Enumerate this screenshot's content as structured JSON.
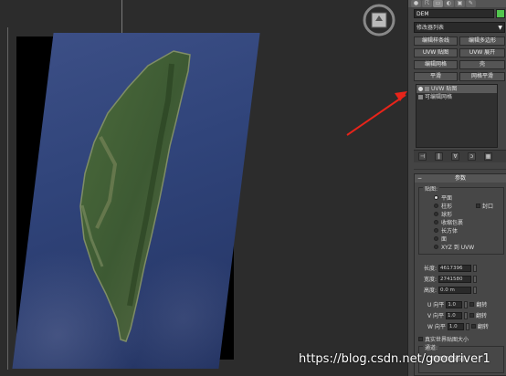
{
  "viewport": {
    "label": "3ds Max perspective viewport"
  },
  "panel": {
    "tabs": [
      "●",
      "☈",
      "▭",
      "◐",
      "▣",
      "✎"
    ],
    "object_name": "DEM",
    "swatch_color": "#52c64e",
    "modifier_list": "修改器列表",
    "buttons": [
      "编辑样条线",
      "编辑多边形",
      "UVW 贴图",
      "UVW 展开",
      "编辑网格",
      "壳",
      "平滑",
      "网格平滑"
    ],
    "stack": [
      {
        "label": "UVW 贴图",
        "selected": true
      },
      {
        "label": "可编辑网格",
        "selected": false
      }
    ],
    "stack_buttons": [
      "⊣",
      "‖",
      "∀",
      "ↄ",
      "▦"
    ],
    "params_title": "参数",
    "mapping_title": "贴图:",
    "mapping_options": [
      {
        "label": "平面",
        "on": true
      },
      {
        "label": "柱形",
        "on": false
      },
      {
        "label": "球形",
        "on": false
      },
      {
        "label": "收缩包裹",
        "on": false
      },
      {
        "label": "长方体",
        "on": false
      },
      {
        "label": "面",
        "on": false
      },
      {
        "label": "XYZ 到 UVW",
        "on": false
      }
    ],
    "cap_label": "封口",
    "length_label": "长度:",
    "length_value": "4617396",
    "width_label": "宽度:",
    "width_value": "2741580",
    "height_label": "高度:",
    "height_value": "0.0 m",
    "u_label": "U 向平",
    "u_value": "1.0",
    "v_label": "V 向平",
    "v_value": "1.0",
    "w_label": "W 向平",
    "w_value": "1.0",
    "flip_label": "翻转",
    "realworld_label": "真实世界贴图大小",
    "channel_title": "通道:",
    "channel_value": "贴图颜色通道"
  },
  "watermark": "https://blog.csdn.net/goodriver1"
}
